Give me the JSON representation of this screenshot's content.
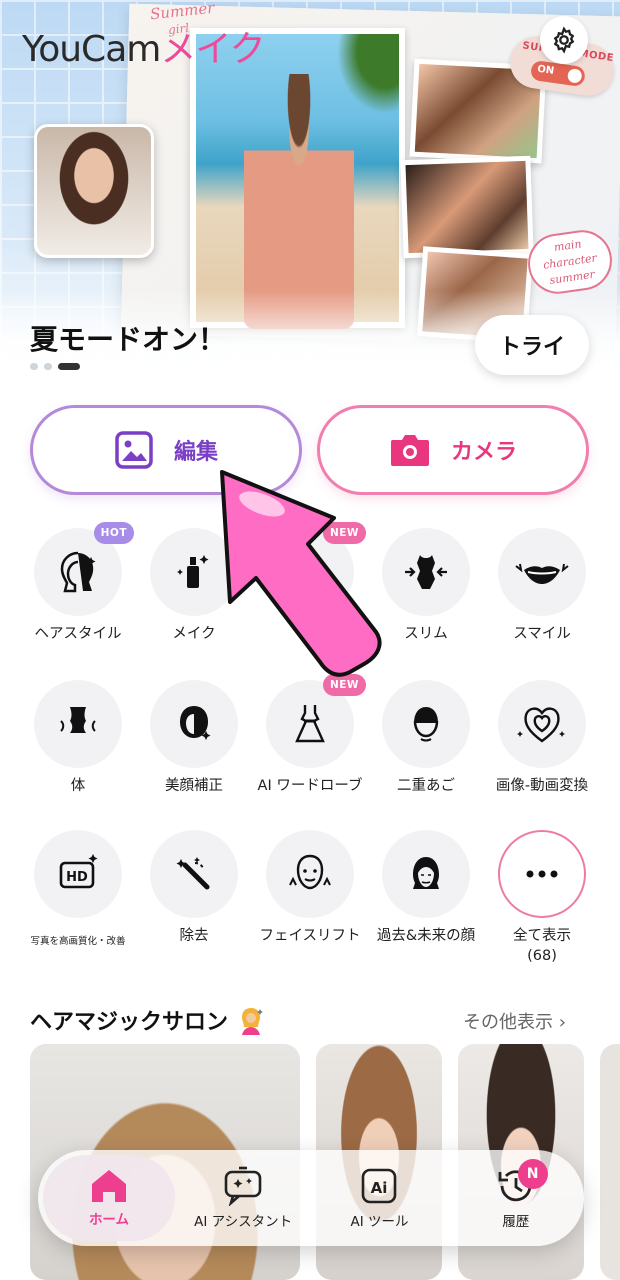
{
  "app": {
    "logo_part1": "YouCam",
    "logo_part2": "メイク"
  },
  "hero": {
    "title": "夏モードオン！",
    "try_label": "トライ",
    "sticker_summer": "Summer",
    "sticker_girl": "girl",
    "sticker_mode_text": "SUMMER MODE",
    "sticker_mode_toggle": "ON",
    "sticker_main_line1": "main",
    "sticker_main_line2": "character",
    "sticker_main_line3": "summer"
  },
  "actions": {
    "edit_label": "編集",
    "camera_label": "カメラ"
  },
  "features": [
    {
      "label": "ヘアスタイル",
      "icon": "hair-icon",
      "badge": "HOT"
    },
    {
      "label": "メイク",
      "icon": "makeup-icon"
    },
    {
      "label": "",
      "icon": "hidden-feature-icon",
      "badge": "NEW"
    },
    {
      "label": "スリム",
      "icon": "slim-icon"
    },
    {
      "label": "スマイル",
      "icon": "smile-icon"
    },
    {
      "label": "体",
      "icon": "body-icon"
    },
    {
      "label": "美顔補正",
      "icon": "beauty-icon"
    },
    {
      "label": "AI ワードローブ",
      "icon": "dress-icon",
      "badge": "NEW"
    },
    {
      "label": "二重あご",
      "icon": "double-chin-icon"
    },
    {
      "label": "画像-動画変換",
      "icon": "photo-to-video-icon"
    },
    {
      "label": "写真を高画質化・改善",
      "icon": "hd-icon"
    },
    {
      "label": "除去",
      "icon": "remove-icon"
    },
    {
      "label": "フェイスリフト",
      "icon": "facelift-icon"
    },
    {
      "label": "過去&未来の顔",
      "icon": "aging-icon"
    },
    {
      "label": "全て表示\n(68)",
      "icon": "more-icon"
    }
  ],
  "salon": {
    "title": "ヘアマジックサロン",
    "more_label": "その他表示 ›"
  },
  "nav": [
    {
      "label": "ホーム",
      "icon": "home-icon",
      "active": true
    },
    {
      "label": "AI アシスタント",
      "icon": "ai-assistant-icon"
    },
    {
      "label": "AI ツール",
      "icon": "ai-tools-icon"
    },
    {
      "label": "履歴",
      "icon": "history-icon",
      "badge": "N"
    }
  ],
  "colors": {
    "brand_pink": "#ee3f8e",
    "edit_purple": "#7b3fc6",
    "arrow_pink": "#ff6cc4"
  }
}
